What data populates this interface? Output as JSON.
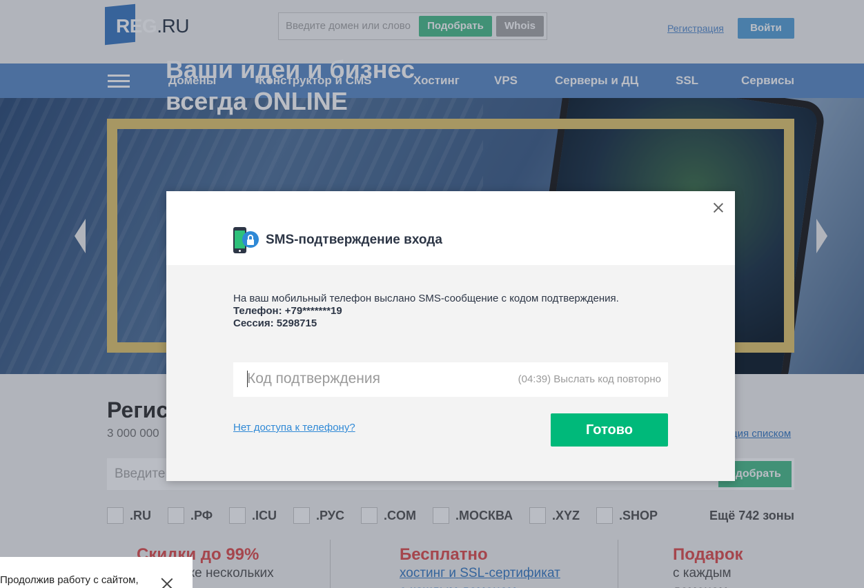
{
  "header": {
    "logo_main": "REG",
    "logo_suffix": ".RU",
    "search_placeholder": "Введите домен или слово",
    "pick_button": "Подобрать",
    "whois_button": "Whois",
    "register_link": "Регистрация",
    "login_button": "Войти"
  },
  "nav": {
    "items": [
      "Домены",
      "Конструктор и CMS",
      "Хостинг",
      "VPS",
      "Серверы и ДЦ",
      "SSL",
      "Сервисы"
    ]
  },
  "hero": {
    "title_line1": "Ваши идеи и бизнес",
    "title_line2": "всегда ONLINE"
  },
  "registration": {
    "title": "Регис",
    "subtitle": "3 000 000",
    "list_link": "ция списком",
    "search_placeholder": "Введите",
    "search_button": "одобрать",
    "zones": [
      ".RU",
      ".РФ",
      ".ICU",
      ".РУС",
      ".COM",
      ".МОСКВА",
      ".XYZ",
      ".SHOP"
    ],
    "more_zones": "Ещё 742 зоны"
  },
  "promos": [
    {
      "title": "Скидки до 99%",
      "text": "ри покупке нескольких"
    },
    {
      "title": "Бесплатно",
      "link1": "хостинг и SSL-сертификат",
      "link2": "с каждым доменом"
    },
    {
      "title": "Подарок",
      "text1": "с каждым",
      "text2": "доменом"
    }
  ],
  "modal": {
    "title": "SMS-подтверждение входа",
    "message": "На ваш мобильный телефон выслано SMS-сообщение с кодом подтверждения.",
    "phone_line": "Телефон: +79*******19",
    "session_line": "Сессия: 5298715",
    "code_placeholder": "Код подтверждения",
    "resend_text": "(04:39) Выслать код повторно",
    "no_access_link": "Нет доступа к телефону?",
    "done_button": "Готово"
  },
  "cookie": {
    "text": "Продолжив работу с сайтом,"
  },
  "colors": {
    "nav_blue": "#5e8dc8",
    "green": "#00b97a",
    "frame_gold": "#e4c870",
    "link_blue": "#2f89d6"
  }
}
